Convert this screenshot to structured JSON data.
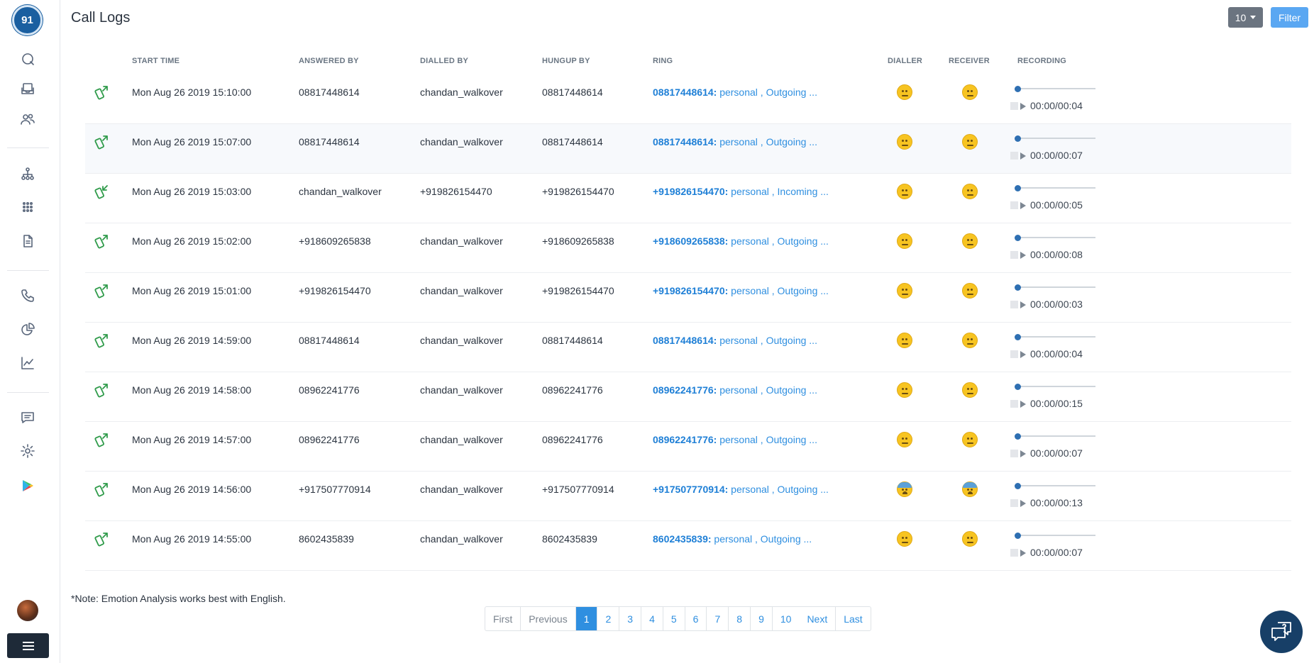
{
  "app": {
    "logo_text": "91",
    "page_title": "Call Logs",
    "page_size_label": "10",
    "filter_label": "Filter"
  },
  "sidebar": {
    "icons": [
      "chat-search-icon",
      "inbox-icon",
      "users-icon",
      "hierarchy-icon",
      "dialpad-icon",
      "document-icon",
      "phone-icon",
      "pie-chart-icon",
      "line-chart-icon",
      "message-icon",
      "settings-icon",
      "play-store-icon"
    ]
  },
  "table": {
    "headers": {
      "start_time": "START TIME",
      "answered_by": "ANSWERED BY",
      "dialled_by": "DIALLED BY",
      "hungup_by": "HUNGUP BY",
      "ring": "RING",
      "dialler": "DIALLER",
      "receiver": "RECEIVER",
      "recording": "RECORDING"
    },
    "rows": [
      {
        "direction": "outgoing",
        "start_time": "Mon Aug 26 2019 15:10:00",
        "answered_by": "08817448614",
        "dialled_by": "chandan_walkover",
        "hungup_by": "08817448614",
        "ring_number": "08817448614:",
        "ring_detail": " personal , Outgoing ...",
        "dialler": "neutral",
        "receiver": "neutral",
        "recording": "00:00/00:04"
      },
      {
        "direction": "outgoing",
        "start_time": "Mon Aug 26 2019 15:07:00",
        "answered_by": "08817448614",
        "dialled_by": "chandan_walkover",
        "hungup_by": "08817448614",
        "ring_number": "08817448614:",
        "ring_detail": " personal , Outgoing ...",
        "dialler": "neutral",
        "receiver": "neutral",
        "recording": "00:00/00:07"
      },
      {
        "direction": "incoming",
        "start_time": "Mon Aug 26 2019 15:03:00",
        "answered_by": "chandan_walkover",
        "dialled_by": "+919826154470",
        "hungup_by": "+919826154470",
        "ring_number": "+919826154470:",
        "ring_detail": " personal , Incoming ...",
        "dialler": "neutral",
        "receiver": "neutral",
        "recording": "00:00/00:05"
      },
      {
        "direction": "outgoing",
        "start_time": "Mon Aug 26 2019 15:02:00",
        "answered_by": "+918609265838",
        "dialled_by": "chandan_walkover",
        "hungup_by": "+918609265838",
        "ring_number": "+918609265838:",
        "ring_detail": " personal , Outgoing ...",
        "dialler": "neutral",
        "receiver": "neutral",
        "recording": "00:00/00:08"
      },
      {
        "direction": "outgoing",
        "start_time": "Mon Aug 26 2019 15:01:00",
        "answered_by": "+919826154470",
        "dialled_by": "chandan_walkover",
        "hungup_by": "+919826154470",
        "ring_number": "+919826154470:",
        "ring_detail": " personal , Outgoing ...",
        "dialler": "neutral",
        "receiver": "neutral",
        "recording": "00:00/00:03"
      },
      {
        "direction": "outgoing",
        "start_time": "Mon Aug 26 2019 14:59:00",
        "answered_by": "08817448614",
        "dialled_by": "chandan_walkover",
        "hungup_by": "08817448614",
        "ring_number": "08817448614:",
        "ring_detail": " personal , Outgoing ...",
        "dialler": "neutral",
        "receiver": "neutral",
        "recording": "00:00/00:04"
      },
      {
        "direction": "outgoing",
        "start_time": "Mon Aug 26 2019 14:58:00",
        "answered_by": "08962241776",
        "dialled_by": "chandan_walkover",
        "hungup_by": "08962241776",
        "ring_number": "08962241776:",
        "ring_detail": " personal , Outgoing ...",
        "dialler": "neutral",
        "receiver": "neutral",
        "recording": "00:00/00:15"
      },
      {
        "direction": "outgoing",
        "start_time": "Mon Aug 26 2019 14:57:00",
        "answered_by": "08962241776",
        "dialled_by": "chandan_walkover",
        "hungup_by": "08962241776",
        "ring_number": "08962241776:",
        "ring_detail": " personal , Outgoing ...",
        "dialler": "neutral",
        "receiver": "neutral",
        "recording": "00:00/00:07"
      },
      {
        "direction": "outgoing",
        "start_time": "Mon Aug 26 2019 14:56:00",
        "answered_by": "+917507770914",
        "dialled_by": "chandan_walkover",
        "hungup_by": "+917507770914",
        "ring_number": "+917507770914:",
        "ring_detail": " personal , Outgoing ...",
        "dialler": "fearful",
        "receiver": "fearful",
        "recording": "00:00/00:13"
      },
      {
        "direction": "outgoing",
        "start_time": "Mon Aug 26 2019 14:55:00",
        "answered_by": "8602435839",
        "dialled_by": "chandan_walkover",
        "hungup_by": "8602435839",
        "ring_number": "8602435839:",
        "ring_detail": " personal , Outgoing ...",
        "dialler": "neutral",
        "receiver": "neutral",
        "recording": "00:00/00:07"
      }
    ]
  },
  "footer": {
    "note": "*Note: Emotion Analysis works best with English.",
    "pagination": {
      "first": "First",
      "previous": "Previous",
      "pages": [
        "1",
        "2",
        "3",
        "4",
        "5",
        "6",
        "7",
        "8",
        "9",
        "10"
      ],
      "active": "1",
      "next": "Next",
      "last": "Last"
    }
  },
  "colors": {
    "accent": "#2f8fe0",
    "call_icon": "#2f9b4a",
    "sidebar_icon": "#58657a",
    "help_button": "#173f67"
  }
}
